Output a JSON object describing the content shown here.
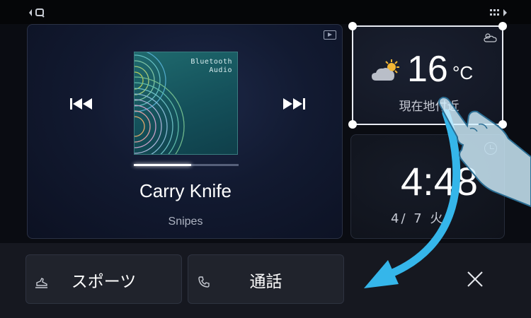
{
  "status_bar": {
    "back_icon": "back-search-icon",
    "apps_icon": "apps-grid-icon"
  },
  "media": {
    "source_icon": "play-source-icon",
    "album_label_line1": "Bluetooth",
    "album_label_line2": "Audio",
    "progress": 0.55,
    "title": "Carry Knife",
    "artist": "Snipes",
    "prev_icon": "previous-track-icon",
    "next_icon": "next-track-icon"
  },
  "weather": {
    "condition_icon": "partly-cloudy-icon",
    "temperature": "16",
    "unit": "°C",
    "location": "現在地付近"
  },
  "clock": {
    "time": "4:48",
    "date": "4/ 7 火"
  },
  "bottom": {
    "buttons": [
      {
        "label": "スポーツ",
        "icon": "sports-shoe-icon"
      },
      {
        "label": "通話",
        "icon": "phone-icon"
      }
    ],
    "close_icon": "close-icon"
  },
  "colors": {
    "accent_arrow": "#35b6ea",
    "selection_border": "#e8ebf2"
  }
}
